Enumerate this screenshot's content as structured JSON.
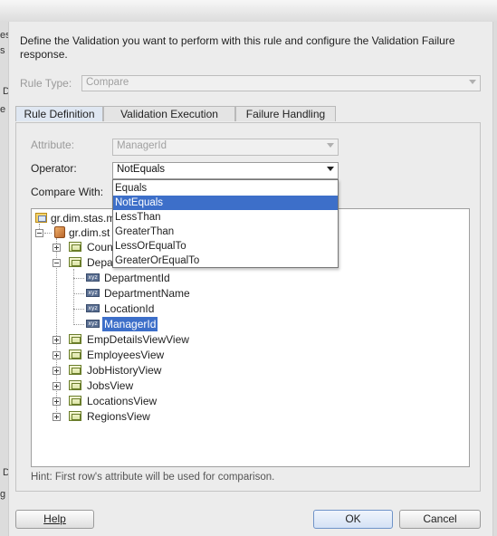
{
  "background": {
    "left_letters": [
      "es",
      "s",
      "D",
      "e"
    ],
    "left_bottom": [
      "D",
      "g"
    ]
  },
  "dialog": {
    "description": "Define the Validation you want to perform with this rule and configure the Validation Failure response.",
    "rule_type": {
      "label": "Rule Type:",
      "value": "Compare"
    },
    "tabs": [
      {
        "label": "Rule Definition",
        "selected": true
      },
      {
        "label": "Validation Execution",
        "selected": false
      },
      {
        "label": "Failure Handling",
        "selected": false
      }
    ],
    "attribute": {
      "label": "Attribute:",
      "value": "ManagerId"
    },
    "operator": {
      "label": "Operator:",
      "value": "NotEquals",
      "options": [
        "Equals",
        "NotEquals",
        "LessThan",
        "GreaterThan",
        "LessOrEqualTo",
        "GreaterOrEqualTo"
      ],
      "selected_index": 1
    },
    "compare_with": {
      "label": "Compare With:"
    },
    "tree": {
      "root": "gr.dim.stas.m",
      "module": "gr.dim.st",
      "items": {
        "countries": "Coun",
        "departments": "Depa",
        "dept_id": "DepartmentId",
        "dept_name": "DepartmentName",
        "location_id": "LocationId",
        "manager_id": "ManagerId",
        "emp_details": "EmpDetailsViewView",
        "employees": "EmployeesView",
        "job_history": "JobHistoryView",
        "jobs": "JobsView",
        "locations": "LocationsView",
        "regions": "RegionsView"
      },
      "attr_icon_text": "xyz"
    },
    "hint": "Hint: First row's attribute will be used for comparison.",
    "buttons": {
      "help": "Help",
      "ok": "OK",
      "cancel": "Cancel"
    }
  },
  "colors": {
    "selection": "#3d6fc9",
    "default_button": "#d4e2f5"
  }
}
